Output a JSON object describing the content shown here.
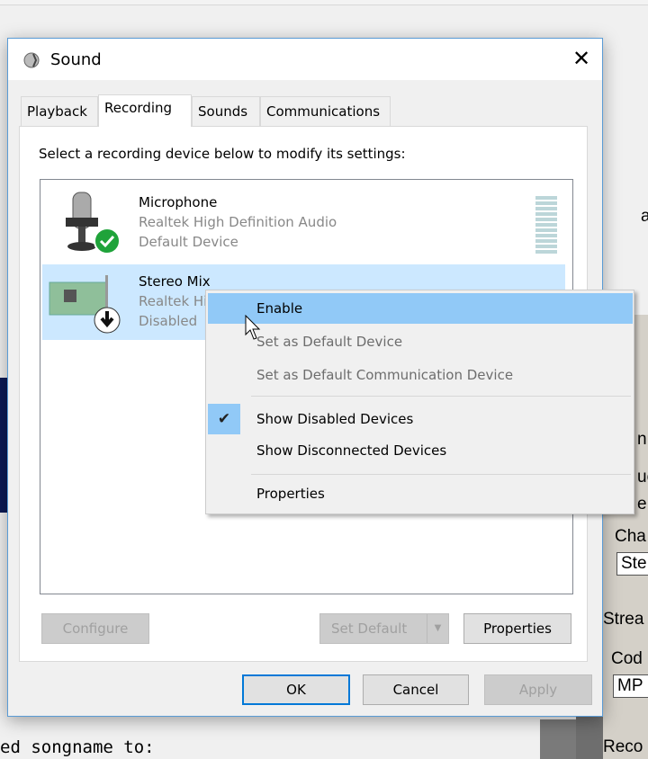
{
  "background": {
    "fragments_right": [
      "a",
      "n",
      "uc",
      "e",
      "Cha",
      "Ste",
      "Strea",
      "Cod",
      "MP",
      "Reco"
    ],
    "console_text": "ed songname to:"
  },
  "dialog": {
    "title": "Sound",
    "close_icon": "close-icon",
    "tabs": [
      {
        "label": "Playback"
      },
      {
        "label": "Recording",
        "active": true
      },
      {
        "label": "Sounds"
      },
      {
        "label": "Communications"
      }
    ],
    "instruction": "Select a recording device below to modify its settings:",
    "devices": [
      {
        "name": "Microphone",
        "driver": "Realtek High Definition Audio",
        "status": "Default Device",
        "icon": "microphone-icon",
        "badge": "green-check-badge"
      },
      {
        "name": "Stereo Mix",
        "driver": "Realtek High Definition Audio",
        "status": "Disabled",
        "icon": "sound-card-icon",
        "badge": "down-arrow-badge",
        "selected": true
      }
    ],
    "buttons": {
      "configure": "Configure",
      "set_default": "Set Default",
      "properties": "Properties",
      "ok": "OK",
      "cancel": "Cancel",
      "apply": "Apply"
    }
  },
  "context_menu": {
    "items": [
      {
        "label": "Enable",
        "highlighted": true
      },
      {
        "label": "Set as Default Device",
        "disabled": true
      },
      {
        "label": "Set as Default Communication Device",
        "disabled": true
      },
      {
        "label": "Show Disabled Devices",
        "checked": true
      },
      {
        "label": "Show Disconnected Devices"
      },
      {
        "label": "Properties"
      }
    ]
  },
  "colors": {
    "accent": "#0078d7",
    "selection": "#cce8ff",
    "menu_highlight": "#91c9f7"
  }
}
